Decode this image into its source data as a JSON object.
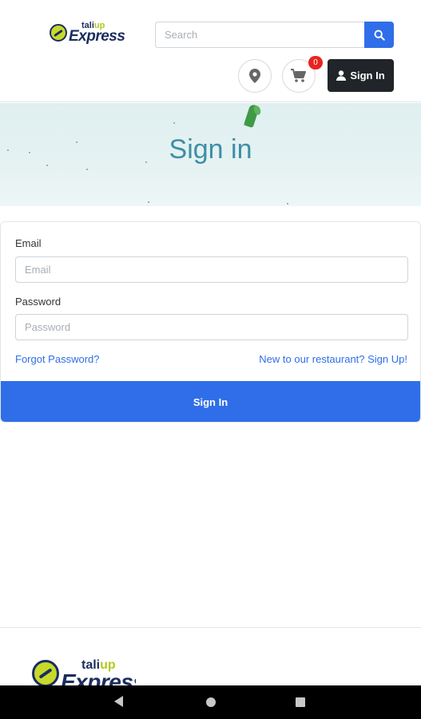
{
  "header": {
    "logo": {
      "small": "tali",
      "small_accent": "up",
      "big": "Express"
    },
    "search": {
      "placeholder": "Search",
      "value": ""
    },
    "cart_count": "0",
    "signin_label": "Sign In"
  },
  "hero": {
    "title": "Sign in"
  },
  "form": {
    "email_label": "Email",
    "email_placeholder": "Email",
    "password_label": "Password",
    "password_placeholder": "Password",
    "forgot_link": "Forgot Password?",
    "signup_link": "New to our restaurant? Sign Up!",
    "submit_label": "Sign In"
  },
  "footer": {
    "logo": {
      "small": "tali",
      "small_accent": "up",
      "big": "Express"
    }
  },
  "colors": {
    "primary": "#2f6ee8",
    "dark_button": "#212529",
    "badge": "#e8241f",
    "hero_title": "#3e8fa6",
    "logo_navy": "#1b2d5e",
    "logo_lime": "#c7d92a"
  },
  "icons": {
    "search": "search-icon",
    "location": "map-marker-icon",
    "cart": "shopping-cart-icon",
    "user": "user-icon"
  }
}
